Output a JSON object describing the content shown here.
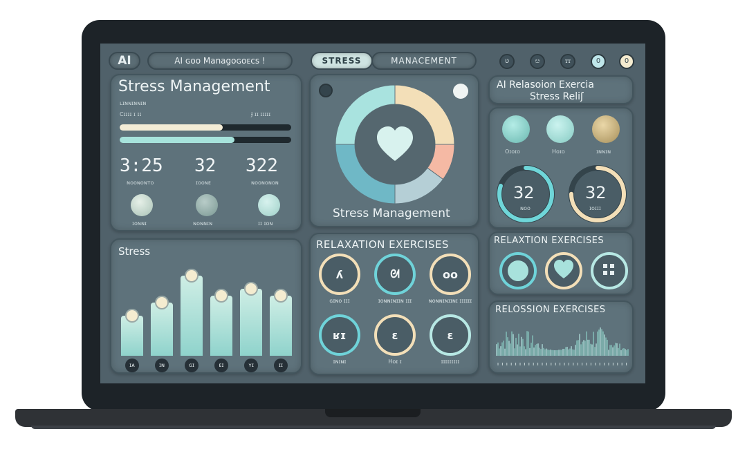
{
  "topbar": {
    "logo": "AI",
    "title": "AI ɢoo Managoɢoᴇᴄꜱ !",
    "tabs": [
      "STRESS",
      "MANACEMENT"
    ],
    "icons": [
      "badge-icon",
      "leaf-icon",
      "grid-icon",
      "circle-icon",
      "power-icon"
    ],
    "icon_glyphs": [
      "ʋ",
      "ೞ",
      "ꭲꭲ",
      "0",
      "0"
    ]
  },
  "stats_panel": {
    "title": "Stress Management",
    "subtitle": "ʟɪɴɴɪɴɴɪɴ",
    "label_left": "Cɪɪɪɪ ɪ ɪɪ",
    "label_right": "Ɉ ɪɪ ɪɪɪɪɪ",
    "progress": [
      0.6,
      0.67
    ],
    "stats": [
      {
        "value": "3:25",
        "label": "ɴᴏᴏɴᴏɴᴛᴏ"
      },
      {
        "value": "32",
        "label": "ɪᴏᴏɴᴇ"
      },
      {
        "value": "322",
        "label": "ɴᴏᴏɴᴏɴᴏɴ"
      }
    ],
    "buttons": [
      {
        "label": "ɪᴏɴɴɪ"
      },
      {
        "label": "ɴᴏɴɴɪɴ"
      },
      {
        "label": "ɪɪ ɪᴏɴ"
      }
    ]
  },
  "center_panel": {
    "title": "Stress Management",
    "donut_segments": [
      {
        "value": 25,
        "color": "#f3dfb8"
      },
      {
        "value": 10,
        "color": "#f5b9a4"
      },
      {
        "value": 15,
        "color": "#b5cfd6"
      },
      {
        "value": 25,
        "color": "#6fb8c6"
      },
      {
        "value": 25,
        "color": "#a9e3df"
      }
    ]
  },
  "relax_panel": {
    "title": "AI Relasoion Exercia",
    "subtitle": "Stress Reliʃ",
    "items": [
      {
        "label": "Oɪᴏɪᴏ",
        "color": "#7fd0c8"
      },
      {
        "label": "Hoɪᴏ",
        "color": "#a8e2dc"
      },
      {
        "label": "ɪɴɴɪɴ",
        "color": "#cdb886"
      }
    ],
    "gauges": [
      {
        "value": "32",
        "label": "ɴᴏᴏ",
        "level": 0.8
      },
      {
        "value": "32",
        "label": "ɪᴏɪɪɪ",
        "level": 0.75
      }
    ]
  },
  "chart_panel": {
    "title": "Stress",
    "icons": [
      "ɪᴀ",
      "ɪɴ",
      "ɢɪ",
      "ᴇɪ",
      "ʏɪ",
      "ɪɪ"
    ]
  },
  "chart_data": {
    "type": "bar",
    "categories": [
      "",
      "",
      "",
      "",
      "",
      ""
    ],
    "values": [
      6,
      8,
      12,
      9,
      10,
      9
    ],
    "ylim": [
      0,
      12.8
    ]
  },
  "exercises_panel": {
    "title": "RELAXATION EXERCISES",
    "items": [
      {
        "glyph": "ʎ",
        "label": "ɢɪɴᴏ ɪɪɪ",
        "ring": "#f3dfb8"
      },
      {
        "glyph": "ᘛ",
        "label": "ɪᴏɴɴɪɴɪɪɴ ɪɪɪ",
        "ring": "#6fd3d9"
      },
      {
        "glyph": "oo",
        "label": "ɴᴏɴɴɪɴɪɪɴɪ ɪɪɪɪɪɪ",
        "ring": "#f3dfb8"
      },
      {
        "glyph": "ʁɪ",
        "label": "ɪɴɪɴɪ",
        "ring": "#6fd3d9"
      },
      {
        "glyph": "ɛ",
        "label": "Hᴏɪ ɪ",
        "ring": "#f3dfb8"
      },
      {
        "glyph": "ɛ",
        "label": "ɪɪɪɪɪɪɪɪɪ",
        "ring": "#b7e8e4"
      }
    ]
  },
  "relax2_panel": {
    "title": "RELAXTION EXERCISES",
    "buttons": [
      "dot-icon",
      "heart-icon",
      "grid-icon"
    ]
  },
  "wave_panel": {
    "title": "RELOSSION EXERCISES"
  }
}
